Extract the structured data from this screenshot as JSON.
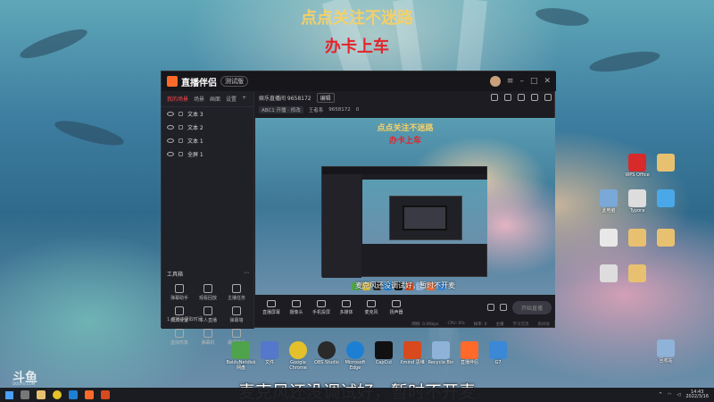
{
  "overlay": {
    "line1": "点点关注不迷路",
    "line2": "办卡上车"
  },
  "app": {
    "name": "直播伴侣",
    "version": "测试版",
    "left_tabs": [
      "我的场景",
      "场景",
      "画面",
      "设置"
    ],
    "layers": [
      "文本 3",
      "文本 2",
      "文本 1",
      "全屏 1"
    ],
    "tools_title": "工具箱",
    "tools": [
      "弹幕助手",
      "观看回放",
      "主播任务",
      "玩法设置",
      "本人直播",
      "弹幕墙",
      "虚拟形象",
      "弹幕机",
      "歌词助手",
      "",
      "",
      ""
    ],
    "bottom_note": "1.直播中录取时间",
    "room_title": "娱乐直播间 9658172",
    "edit_label": "编辑",
    "area_chip": "ABC1 开播 · 修改",
    "room_id_label": "王者系",
    "room_id": "9658172",
    "count": "0",
    "preview_line1": "点点关注不迷路",
    "preview_line2": "办卡上车",
    "preview_sub": "麦克风还没调试好，暂时不开麦",
    "live_tools": [
      "直播屏幕",
      "摄像头",
      "手机投屏",
      "多媒体",
      "麦克风",
      "扬声器"
    ],
    "start_button": "开始直播",
    "status": [
      "网络: 0.0Kbps",
      "CPU: 0%",
      "帧率: 0",
      "主播",
      "学习交流",
      "房间号"
    ]
  },
  "desktop_icons": [
    {
      "label": "WPS Office",
      "color": "#d72a2a"
    },
    {
      "label": "",
      "color": "#e8c170"
    },
    {
      "label": "此电脑",
      "color": "#7aa9d8"
    },
    {
      "label": "Typora",
      "color": "#dddddd"
    },
    {
      "label": "",
      "color": "#4aa8e8"
    },
    {
      "label": "",
      "color": "#e8e8e8"
    },
    {
      "label": "",
      "color": "#e8c170"
    },
    {
      "label": "",
      "color": "#e8c170"
    },
    {
      "label": "",
      "color": "#dddddd"
    },
    {
      "label": "",
      "color": "#e8c170"
    }
  ],
  "dock_icons": [
    {
      "label": "BaiduNetdisk 网盘",
      "color": "#4fa34a"
    },
    {
      "label": "文件",
      "color": "#5577cc"
    },
    {
      "label": "Google Chrome",
      "color": "#e4c12b"
    },
    {
      "label": "OBS Studio",
      "color": "#2a2a2a"
    },
    {
      "label": "Microsoft Edge",
      "color": "#1d7fd3"
    },
    {
      "label": "CapCut",
      "color": "#111111"
    },
    {
      "label": "Xmind 思维",
      "color": "#d64a1d"
    },
    {
      "label": "Recycle Bin",
      "color": "#8fb2d8"
    },
    {
      "label": "直播伴侣",
      "color": "#ff6a2b"
    },
    {
      "label": "G7",
      "color": "#3a88d6"
    }
  ],
  "recycle_label": "回收站",
  "subtitle": "麦克风还没调试好，暂时不开麦",
  "watermark": "斗鱼",
  "watermark_sub": "DOUYU.COM",
  "clock": {
    "time": "14:43",
    "date": "2022/3/16"
  }
}
